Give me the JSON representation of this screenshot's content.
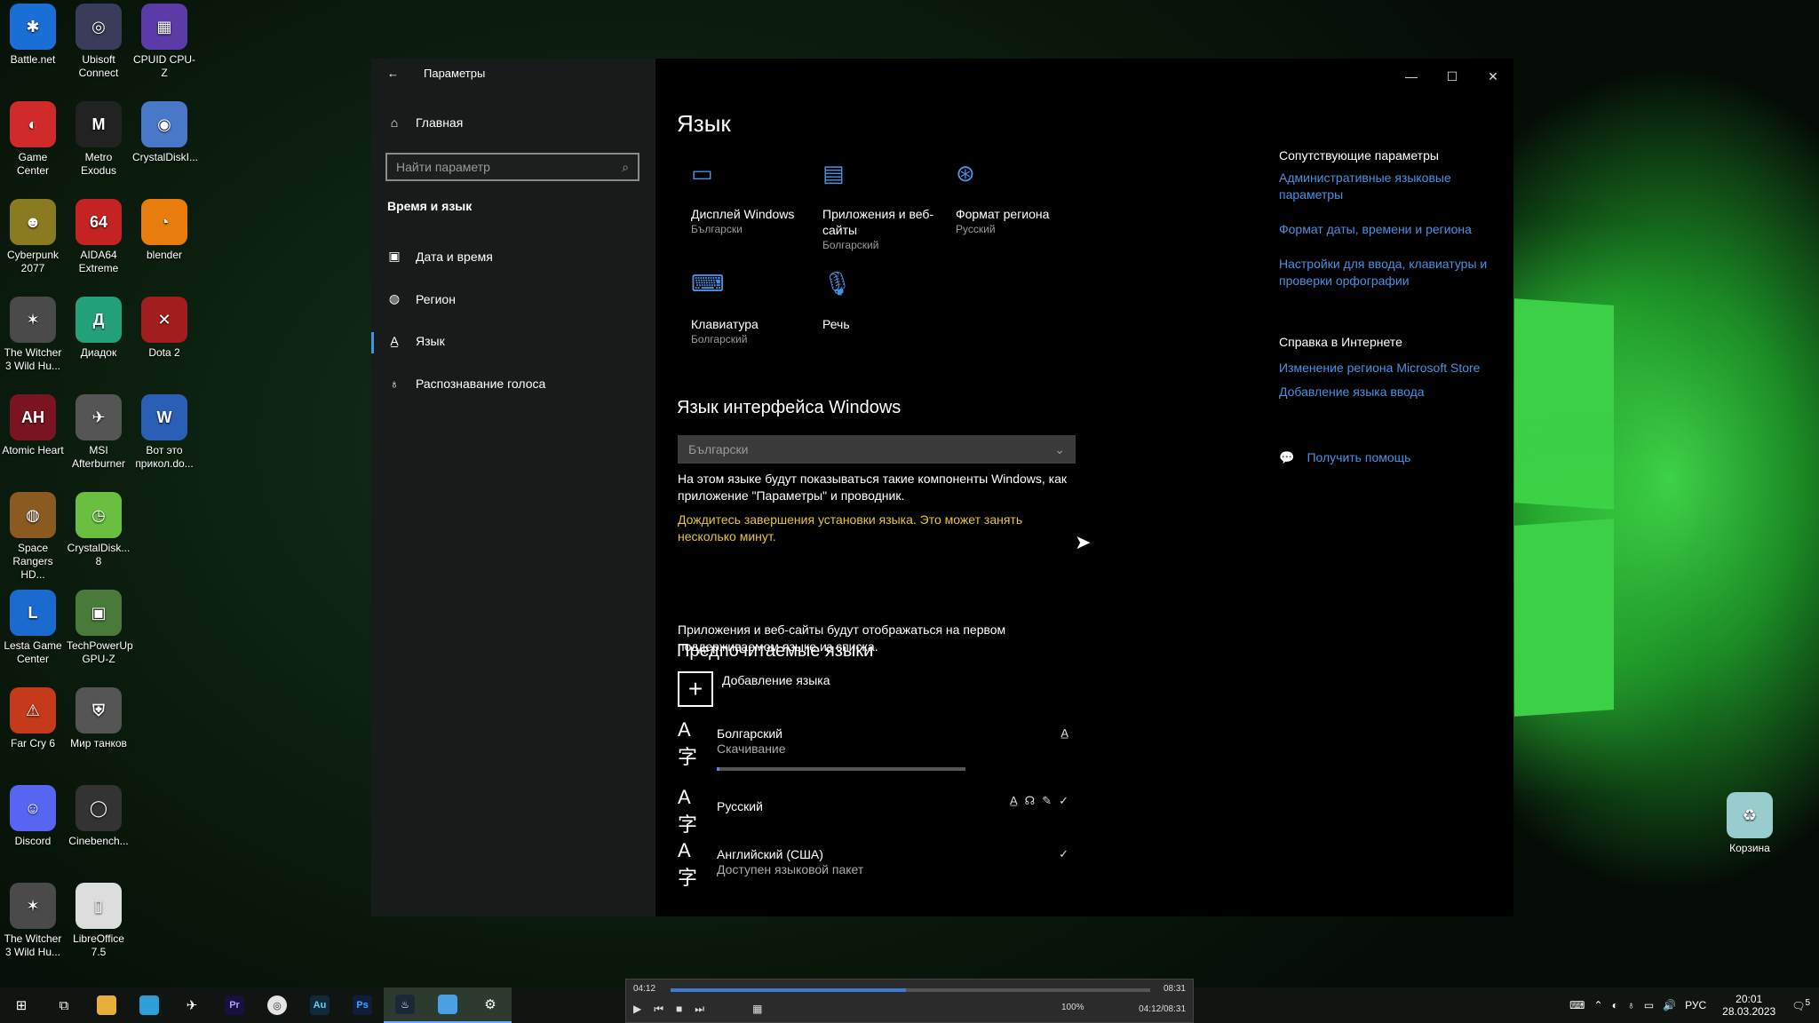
{
  "desktop": {
    "icons": [
      {
        "label": "Battle.net",
        "color": "#1a6fd6",
        "glyph": "✱"
      },
      {
        "label": "Ubisoft Connect",
        "color": "#3b3b5a",
        "glyph": "◎"
      },
      {
        "label": "CPUID CPU-Z",
        "color": "#5a3ba8",
        "glyph": "▦"
      },
      {
        "label": "Game Center",
        "color": "#d02a2a",
        "glyph": "◐"
      },
      {
        "label": "Metro Exodus",
        "color": "#222",
        "glyph": "M"
      },
      {
        "label": "CrystalDiskI...",
        "color": "#4a78c8",
        "glyph": "◉"
      },
      {
        "label": "Cyberpunk 2077",
        "color": "#8a7a20",
        "glyph": "☻"
      },
      {
        "label": "AIDA64 Extreme",
        "color": "#c52222",
        "glyph": "64"
      },
      {
        "label": "blender",
        "color": "#e87d0d",
        "glyph": "◔"
      },
      {
        "label": "The Witcher 3 Wild Hu...",
        "color": "#4a4a4a",
        "glyph": "✶"
      },
      {
        "label": "Диадок",
        "color": "#23a27a",
        "glyph": "Д"
      },
      {
        "label": "Dota 2",
        "color": "#a21e1e",
        "glyph": "✕"
      },
      {
        "label": "Atomic Heart",
        "color": "#7a1420",
        "glyph": "AH"
      },
      {
        "label": "MSI Afterburner",
        "color": "#555",
        "glyph": "✈"
      },
      {
        "label": "Вот это прикол.do...",
        "color": "#2b5fb5",
        "glyph": "W"
      },
      {
        "label": "Space Rangers HD...",
        "color": "#8a5a20",
        "glyph": "◍"
      },
      {
        "label": "CrystalDisk... 8",
        "color": "#6abf40",
        "glyph": "◷"
      },
      {
        "label": "Lesta Game Center",
        "color": "#1b6ad0",
        "glyph": "L"
      },
      {
        "label": "TechPowerUp GPU-Z",
        "color": "#4a7a3a",
        "glyph": "▣"
      },
      {
        "label": "Far Cry 6",
        "color": "#c43a1a",
        "glyph": "⚠"
      },
      {
        "label": "Мир танков",
        "color": "#555",
        "glyph": "⛨"
      },
      {
        "label": "Discord",
        "color": "#5865f2",
        "glyph": "☺"
      },
      {
        "label": "Cinebench...",
        "color": "#333",
        "glyph": "◯"
      },
      {
        "label": "The Witcher 3 Wild Hu...",
        "color": "#4a4a4a",
        "glyph": "✶"
      },
      {
        "label": "LibreOffice 7.5",
        "color": "#ddd",
        "glyph": "▯"
      },
      {
        "label": "Корзина",
        "color": "#9cc",
        "glyph": "♻"
      }
    ]
  },
  "window": {
    "title": "Параметры",
    "nav": {
      "home": "Главная",
      "search_placeholder": "Найти параметр",
      "section": "Время и язык",
      "items": [
        "Дата и время",
        "Регион",
        "Язык",
        "Распознавание голоса"
      ]
    },
    "page_title": "Язык",
    "tiles": [
      {
        "label": "Дисплей Windows",
        "sub": "Български",
        "icon": "display-icon"
      },
      {
        "label": "Приложения и веб-сайты",
        "sub": "Болгарский",
        "icon": "apps-icon"
      },
      {
        "label": "Формат региона",
        "sub": "Русский",
        "icon": "region-format-icon"
      },
      {
        "label": "Клавиатура",
        "sub": "Болгарский",
        "icon": "keyboard-icon"
      },
      {
        "label": "Речь",
        "sub": "",
        "icon": "microphone-icon"
      }
    ],
    "ui_lang": {
      "heading": "Язык интерфейса Windows",
      "selected": "Български",
      "desc": "На этом языке будут показываться такие компоненты Windows, как приложение \"Параметры\" и проводник.",
      "warning": "Дождитесь завершения установки языка. Это может занять несколько минут."
    },
    "preferred": {
      "heading": "Предпочитаемые языки",
      "desc": "Приложения и веб-сайты будут отображаться на первом поддерживаемом языке из списка.",
      "add": "Добавление языка",
      "languages": [
        {
          "name": "Болгарский",
          "status": "Скачивание",
          "progress": 0.01
        },
        {
          "name": "Русский",
          "status": ""
        },
        {
          "name": "Английский (США)",
          "status": "Доступен языковой пакет"
        }
      ]
    },
    "related": {
      "heading": "Сопутствующие параметры",
      "links": [
        "Административные языковые параметры",
        "Формат даты, времени и региона",
        "Настройки для ввода, клавиатуры и проверки орфографии"
      ],
      "web_heading": "Справка в Интернете",
      "web_links": [
        "Изменение региона Microsoft Store",
        "Добавление языка ввода"
      ],
      "help": "Получить помощь"
    }
  },
  "player": {
    "time_current": "04:12",
    "time_total": "08:31",
    "time_combined": "04:12/08:31",
    "progress": 0.49,
    "volume": "100%"
  },
  "taskbar": {
    "lang": "РУС",
    "time": "20:01",
    "date": "28.03.2023",
    "notifications": "5"
  }
}
